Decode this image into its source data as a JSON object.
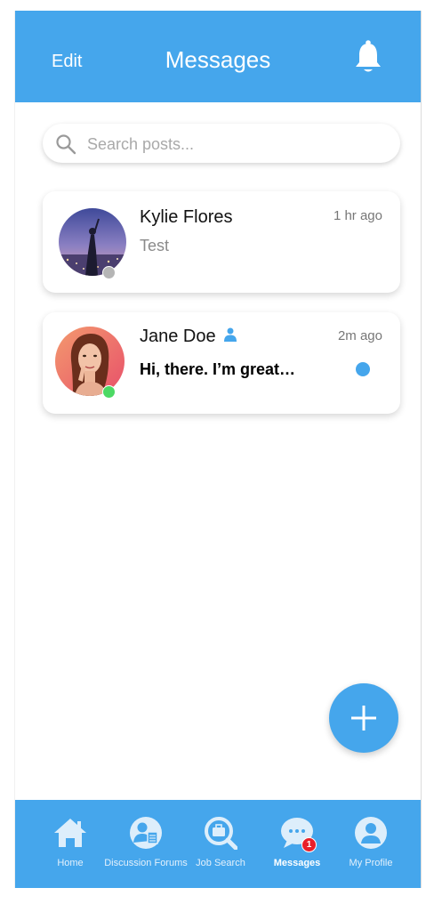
{
  "header": {
    "edit_label": "Edit",
    "title": "Messages",
    "bell_icon": "bell-icon"
  },
  "search": {
    "placeholder": "Search posts..."
  },
  "conversations": [
    {
      "name": "Kylie Flores",
      "time": "1 hr ago",
      "preview": "Test",
      "online": false,
      "unread": false
    },
    {
      "name": "Jane Doe",
      "time": "2m ago",
      "preview": "Hi, there. I’m great…",
      "online": true,
      "unread": true,
      "contact_icon": "person-icon"
    }
  ],
  "fab": {
    "icon": "plus-icon"
  },
  "tabbar": {
    "tabs": [
      {
        "label": "Home",
        "icon": "home-icon",
        "active": false
      },
      {
        "label": "Discussion Forums",
        "icon": "forum-icon",
        "active": false
      },
      {
        "label": "Job Search",
        "icon": "job-search-icon",
        "active": false
      },
      {
        "label": "Messages",
        "icon": "messages-icon",
        "active": true,
        "badge": "1"
      },
      {
        "label": "My Profile",
        "icon": "profile-icon",
        "active": false
      }
    ]
  },
  "colors": {
    "primary": "#45a6ec",
    "online": "#4cd964",
    "offline": "#b5b5b5",
    "badge": "#e8202a",
    "unread_dot": "#45a6ec"
  }
}
